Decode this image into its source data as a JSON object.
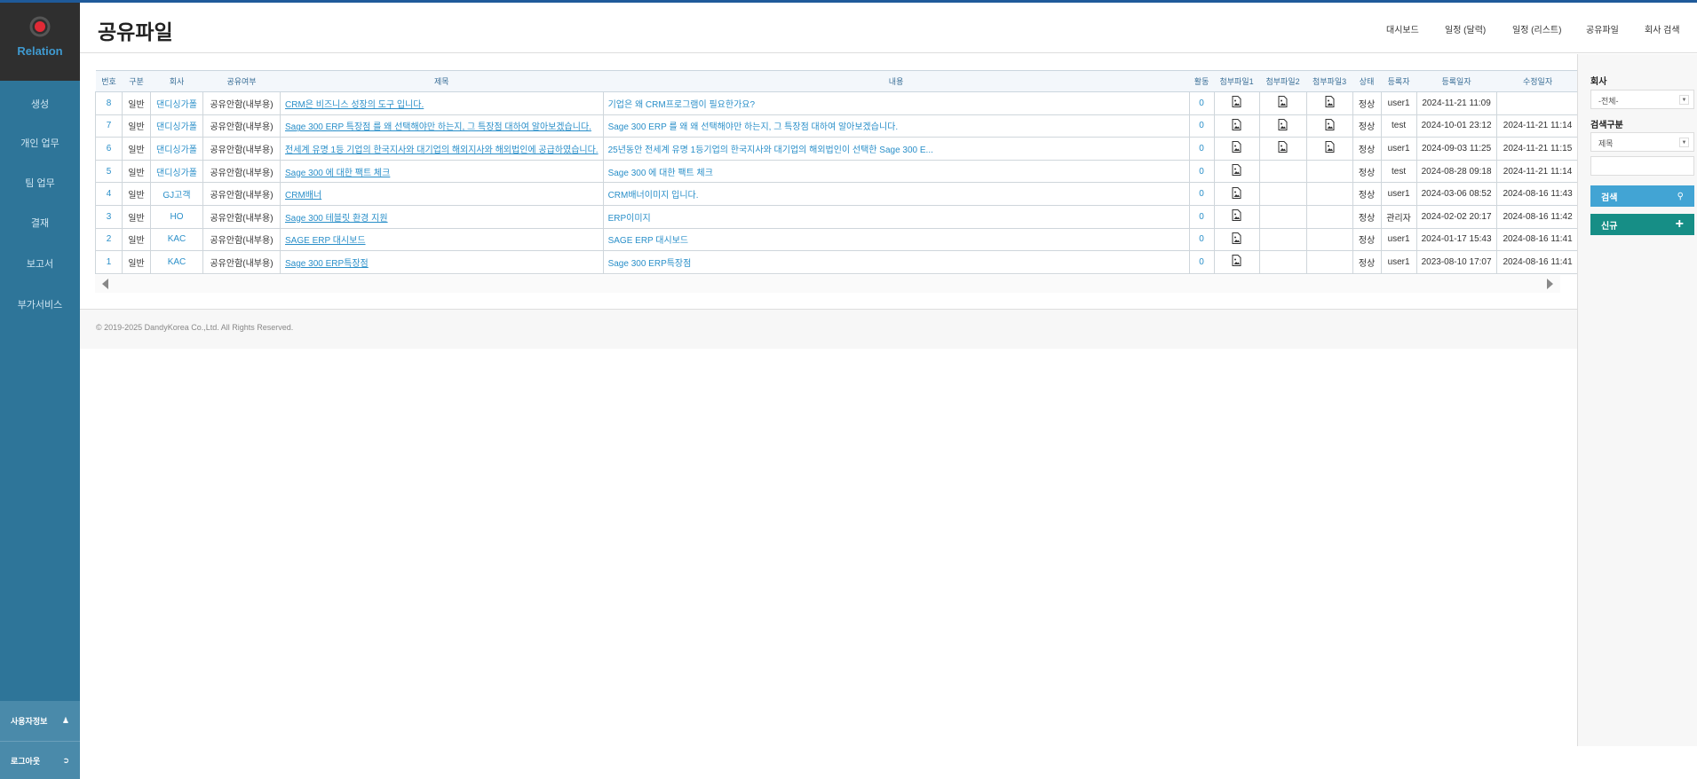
{
  "app": {
    "brand": "Relation"
  },
  "sidebar": {
    "items": [
      "생성",
      "개인 업무",
      "팀 업무",
      "결재",
      "보고서",
      "부가서비스"
    ],
    "user_info": "사용자정보",
    "logout": "로그아웃"
  },
  "header": {
    "title": "공유파일",
    "nav": [
      "대시보드",
      "일정 (달력)",
      "일정 (리스트)",
      "공유파일",
      "회사 검색"
    ]
  },
  "table": {
    "columns": [
      "번호",
      "구분",
      "회사",
      "공유여부",
      "제목",
      "내용",
      "활동",
      "첨부파일1",
      "첨부파일2",
      "첨부파일3",
      "상태",
      "등록자",
      "등록일자",
      "수정일자"
    ],
    "rows": [
      {
        "no": "8",
        "type": "일반",
        "company": "댄디싱가폴",
        "share": "공유안함(내부용)",
        "title": "CRM은 비즈니스 성장의 도구 입니다.",
        "content": "기업은 왜 CRM프로그램이 필요한가요?",
        "activity": "0",
        "files": [
          1,
          1,
          1
        ],
        "status": "정상",
        "author": "user1",
        "created": "2024-11-21 11:09",
        "modified": ""
      },
      {
        "no": "7",
        "type": "일반",
        "company": "댄디싱가폴",
        "share": "공유안함(내부용)",
        "title": "Sage 300 ERP 특장점 를 왜 선택해야만 하는지, 그 특장점 대하여 알아보겠습니다.",
        "content": "Sage 300 ERP 를 왜 왜 선택해야만 하는지, 그 특장점 대하여 알아보겠습니다.",
        "activity": "0",
        "files": [
          1,
          1,
          1
        ],
        "status": "정상",
        "author": "test",
        "created": "2024-10-01 23:12",
        "modified": "2024-11-21 11:14"
      },
      {
        "no": "6",
        "type": "일반",
        "company": "댄디싱가폴",
        "share": "공유안함(내부용)",
        "title": "전세계 유명 1등 기업의 한국지사와 대기업의 해외지사와 해외법인에 공급하였습니다.",
        "content": "25년동안 전세계 유명 1등기업의 한국지사와 대기업의 해외법인이 선택한 Sage 300 E...",
        "activity": "0",
        "files": [
          1,
          1,
          1
        ],
        "status": "정상",
        "author": "user1",
        "created": "2024-09-03 11:25",
        "modified": "2024-11-21 11:15"
      },
      {
        "no": "5",
        "type": "일반",
        "company": "댄디싱가폴",
        "share": "공유안함(내부용)",
        "title": "Sage 300 에 대한 팩트 체크",
        "content": "Sage 300 에 대한 팩트 체크",
        "activity": "0",
        "files": [
          1,
          0,
          0
        ],
        "status": "정상",
        "author": "test",
        "created": "2024-08-28 09:18",
        "modified": "2024-11-21 11:14"
      },
      {
        "no": "4",
        "type": "일반",
        "company": "GJ고객",
        "share": "공유안함(내부용)",
        "title": "CRM배너",
        "content": "CRM배너이미지 입니다.",
        "activity": "0",
        "files": [
          1,
          0,
          0
        ],
        "status": "정상",
        "author": "user1",
        "created": "2024-03-06 08:52",
        "modified": "2024-08-16 11:43"
      },
      {
        "no": "3",
        "type": "일반",
        "company": "HO",
        "share": "공유안함(내부용)",
        "title": "Sage 300 테블릿 환경 지원",
        "content": "ERP이미지",
        "activity": "0",
        "files": [
          1,
          0,
          0
        ],
        "status": "정상",
        "author": "관리자",
        "created": "2024-02-02 20:17",
        "modified": "2024-08-16 11:42"
      },
      {
        "no": "2",
        "type": "일반",
        "company": "KAC",
        "share": "공유안함(내부용)",
        "title": "SAGE ERP 대시보드",
        "content": "SAGE ERP 대시보드",
        "activity": "0",
        "files": [
          1,
          0,
          0
        ],
        "status": "정상",
        "author": "user1",
        "created": "2024-01-17 15:43",
        "modified": "2024-08-16 11:41"
      },
      {
        "no": "1",
        "type": "일반",
        "company": "KAC",
        "share": "공유안함(내부용)",
        "title": "Sage 300 ERP특장점",
        "content": "Sage 300 ERP특장점",
        "activity": "0",
        "files": [
          1,
          0,
          0
        ],
        "status": "정상",
        "author": "user1",
        "created": "2023-08-10 17:07",
        "modified": "2024-08-16 11:41"
      }
    ]
  },
  "footer": {
    "copyright": "© 2019-2025 DandyKorea Co.,Ltd. All Rights Reserved."
  },
  "panel": {
    "company_label": "회사",
    "company_value": "-전체-",
    "search_type_label": "검색구분",
    "search_type_value": "제목",
    "search_value": "",
    "search_button": "검색",
    "new_button": "신규"
  },
  "colors": {
    "sidebar": "#2e7599",
    "link": "#2a8fc9",
    "search": "#42a4d4",
    "new": "#168e86"
  }
}
